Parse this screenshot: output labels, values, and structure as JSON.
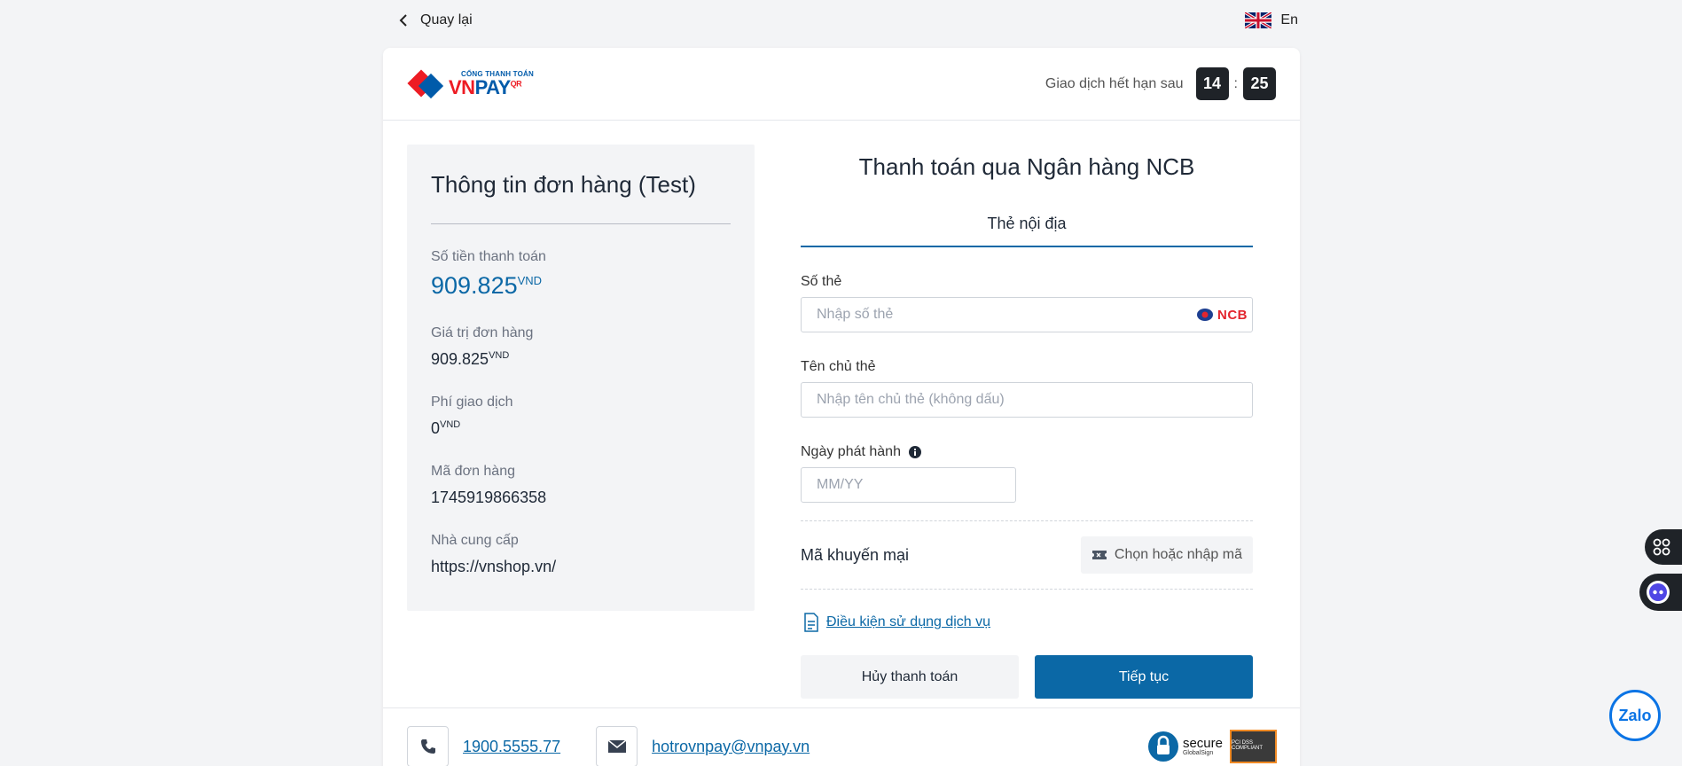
{
  "topbar": {
    "back_label": "Quay lại",
    "lang_label": "En"
  },
  "brand": {
    "small": "CỔNG THANH TOÁN",
    "vn": "VN",
    "pay": "PAY",
    "qr": "QR"
  },
  "timer": {
    "label": "Giao dịch hết hạn sau",
    "minutes": "14",
    "separator": ":",
    "seconds": "25"
  },
  "order": {
    "title": "Thông tin đơn hàng (Test)",
    "amount_label": "Số tiền thanh toán",
    "amount_value": "909.825",
    "currency": "VND",
    "order_value_label": "Giá trị đơn hàng",
    "order_value": "909.825",
    "fee_label": "Phí giao dịch",
    "fee_value": "0",
    "order_id_label": "Mã đơn hàng",
    "order_id": "1745919866358",
    "provider_label": "Nhà cung cấp",
    "provider": "https://vnshop.vn/"
  },
  "payment": {
    "title": "Thanh toán qua Ngân hàng NCB",
    "tab": "Thẻ nội địa",
    "card_number_label": "Số thẻ",
    "card_number_placeholder": "Nhập số thẻ",
    "bank_logo_text": "NCB",
    "card_holder_label": "Tên chủ thẻ",
    "card_holder_placeholder": "Nhập tên chủ thẻ (không dấu)",
    "issue_date_label": "Ngày phát hành",
    "issue_date_placeholder": "MM/YY",
    "promo_label": "Mã khuyến mại",
    "promo_button": "Chọn hoặc nhập mã",
    "terms_link": "Điều kiện sử dụng dịch vụ",
    "cancel_button": "Hủy thanh toán",
    "continue_button": "Tiếp tục"
  },
  "footer": {
    "phone": "1900.5555.77",
    "email": "hotrovnpay@vnpay.vn",
    "secure_text": "secure",
    "secure_sub": "GlobalSign",
    "pci_text": "PCI DSS COMPLIANT"
  },
  "widgets": {
    "zalo": "Zalo"
  },
  "colors": {
    "primary": "#0b68a6",
    "brand_red": "#ed1c24",
    "dark": "#1f2328"
  }
}
